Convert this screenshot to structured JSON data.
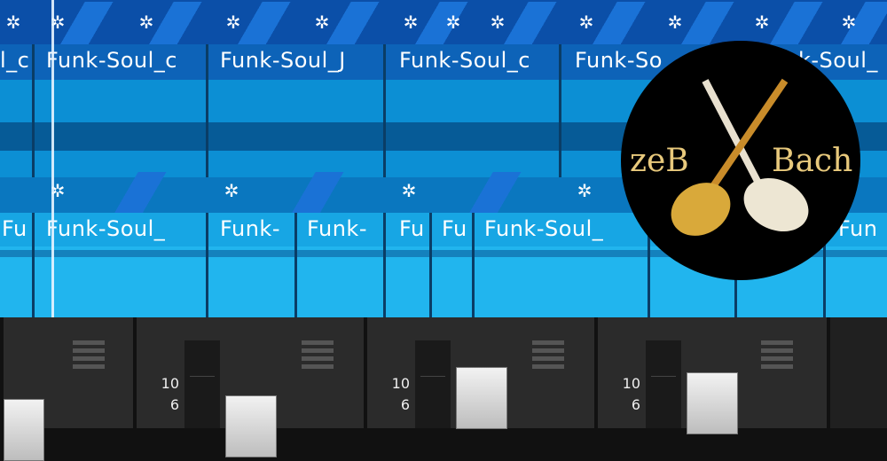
{
  "tracks": [
    {
      "clips": [
        {
          "name": "Funk-Soul_c"
        },
        {
          "name": "Funk-Soul_c"
        },
        {
          "name": "Funk-Soul_J"
        },
        {
          "name": "Funk-Soul_c"
        },
        {
          "name": "Funk-So"
        },
        {
          "name": "k-Soul_"
        }
      ]
    },
    {
      "clips": [
        {
          "name": "Fu"
        },
        {
          "name": "Funk-Soul_"
        },
        {
          "name": "Funk-"
        },
        {
          "name": "Funk-"
        },
        {
          "name": "Fu"
        },
        {
          "name": "Fu"
        },
        {
          "name": "Funk-Soul_"
        },
        {
          "name": "Fun"
        }
      ]
    }
  ],
  "logo": {
    "text_left": "zeB",
    "text_right": "Bach"
  },
  "mixer": {
    "scale_10": "10",
    "scale_6": "6"
  },
  "icons": {
    "clip_gear": "gear-icon"
  },
  "colors": {
    "accent": "#0b4fa8",
    "track2": "#21b5ee"
  }
}
